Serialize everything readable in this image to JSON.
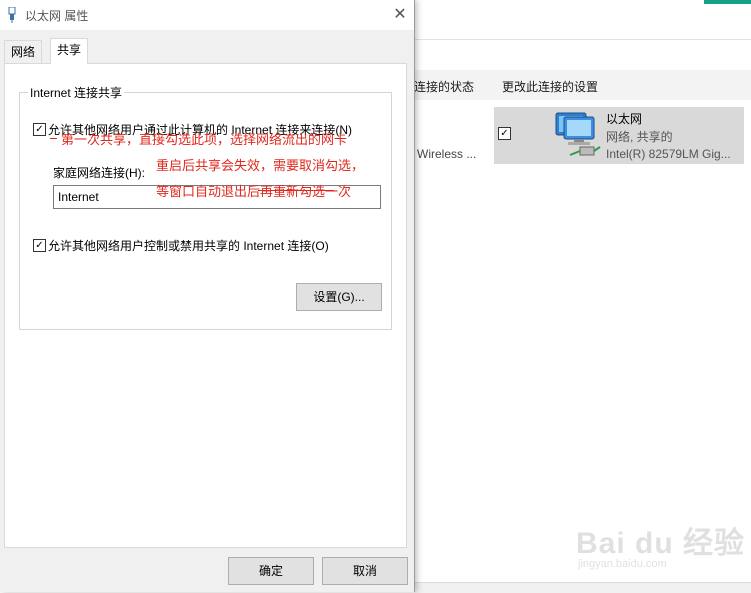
{
  "background_window": {
    "toolbar": [
      "连接的状态",
      "更改此连接的设置"
    ],
    "wireless_label": "Wireless ...",
    "ethernet_item": {
      "checked": true,
      "name": "以太网",
      "status": "网络, 共享的",
      "device": "Intel(R) 82579LM Gig..."
    }
  },
  "dialog": {
    "title": "以太网 属性",
    "tabs": [
      {
        "label": "网络",
        "active": false
      },
      {
        "label": "共享",
        "active": true
      }
    ],
    "group_title": "Internet 连接共享",
    "allow_connect": {
      "checked": true,
      "label": "允许其他网络用户通过此计算机的 Internet 连接来连接(N)"
    },
    "home_network": {
      "label": "家庭网络连接(H):",
      "value": "Internet"
    },
    "allow_control": {
      "checked": true,
      "label": "允许其他网络用户控制或禁用共享的 Internet 连接(O)"
    },
    "settings_button": "设置(G)...",
    "ok_button": "确定",
    "cancel_button": "取消"
  },
  "annotations": [
    "第一次共享，直接勾选此项，选择网络流出的网卡",
    "重启后共享会失效，需要取消勾选，",
    "等窗口自动退出后再重新勾选一次"
  ],
  "watermark": {
    "logo": "Bai du 经验",
    "url": "jingyan.baidu.com"
  },
  "colors": {
    "annotation": "#e0281e",
    "dialog_bg": "#f0f0f0",
    "selected_item_bg": "#d9d9d9",
    "accent_strip": "#16a085"
  }
}
